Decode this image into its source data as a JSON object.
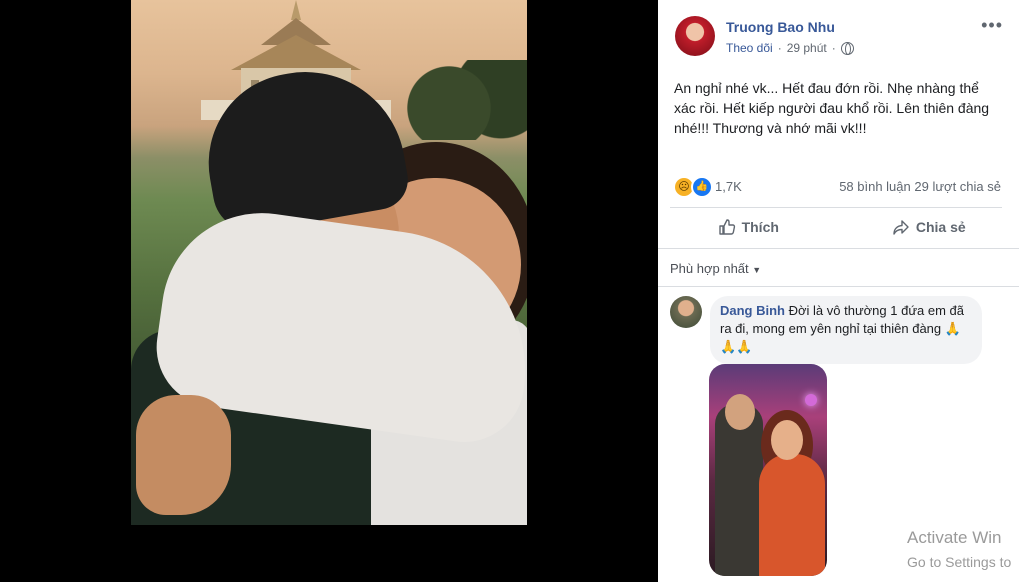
{
  "post": {
    "author": "Truong Bao Nhu",
    "follow": "Theo dõi",
    "time": "29 phút",
    "more": "•••",
    "caption": "An nghỉ nhé vk... Hết đau đớn rồi. Nhẹ nhàng thể xác rồi. Hết kiếp người đau khổ rồi. Lên thiên đàng nhé!!! Thương và nhớ mãi vk!!!"
  },
  "reactions": {
    "count": "1,7K",
    "comments": "58 bình luận",
    "shares": "29 lượt chia sẻ"
  },
  "actions": {
    "like": "Thích",
    "share": "Chia sẻ"
  },
  "comments": {
    "sort": "Phù hợp nhất",
    "items": [
      {
        "name": "Dang Binh",
        "text": "Đời là vô thường 1 đứa em đã ra đi, mong em yên nghỉ tại thiên đàng 🙏 🙏🙏"
      }
    ]
  },
  "watermark": {
    "title": "Activate Win",
    "subtitle": "Go to Settings to"
  },
  "colors": {
    "link": "#385898",
    "like": "#1877f2",
    "sad": "#f7b125"
  },
  "icons": [
    "globe-icon",
    "more-icon",
    "sad-reaction-icon",
    "like-reaction-icon",
    "thumbs-up-icon",
    "share-arrow-icon",
    "chevron-down-icon"
  ]
}
